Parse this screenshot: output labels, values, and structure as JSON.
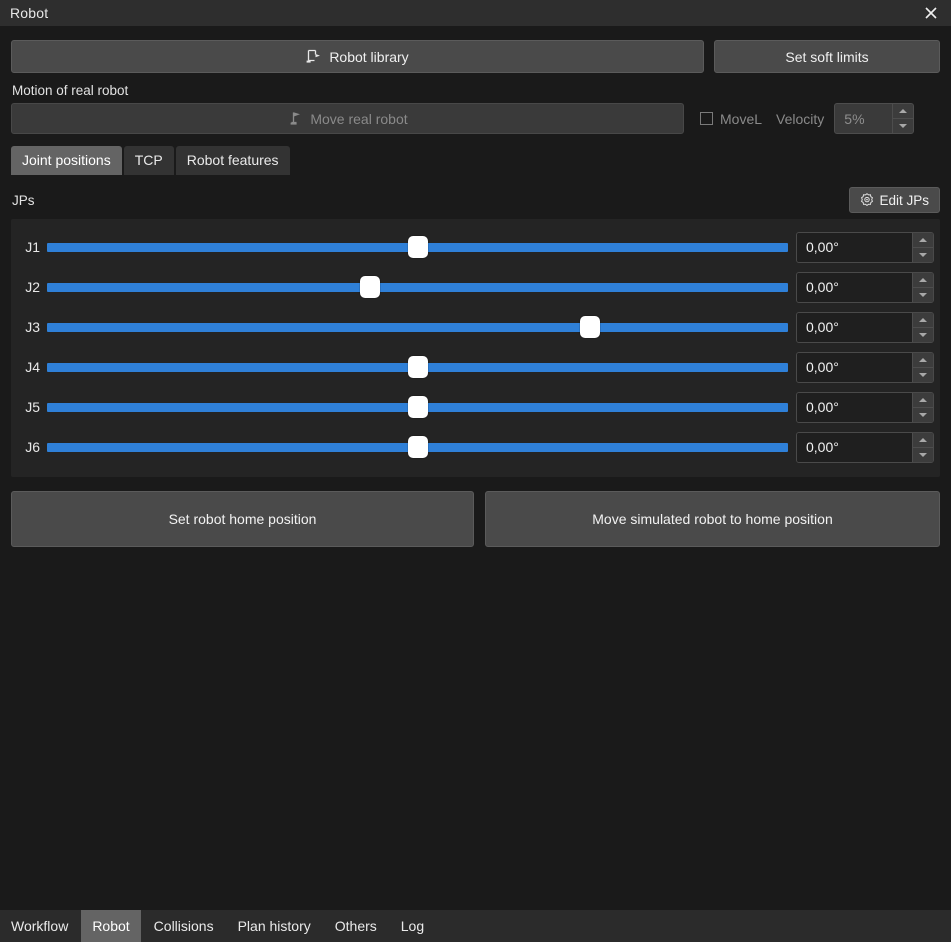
{
  "window": {
    "title": "Robot",
    "close_icon": "close-icon"
  },
  "toolbar": {
    "robot_library_label": "Robot library",
    "robot_library_icon": "robot-arm-icon",
    "set_soft_limits_label": "Set soft limits"
  },
  "motion": {
    "section_label": "Motion of real robot",
    "move_real_robot_label": "Move real robot",
    "move_real_robot_icon": "robot-arm-icon",
    "movel_label": "MoveL",
    "movel_checked": false,
    "velocity_label": "Velocity",
    "velocity_value": "5%",
    "spin_up_icon": "chevron-up-icon",
    "spin_down_icon": "chevron-down-icon"
  },
  "tabs": {
    "items": [
      {
        "label": "Joint positions",
        "active": true
      },
      {
        "label": "TCP",
        "active": false
      },
      {
        "label": "Robot features",
        "active": false
      }
    ]
  },
  "jps": {
    "label": "JPs",
    "edit_button_label": "Edit JPs",
    "edit_button_icon": "gear-target-icon",
    "track_color": "#2f80d8",
    "handle_color": "#ffffff",
    "joints": [
      {
        "name": "J1",
        "value": "0,00°",
        "handle_percent": 50.1
      },
      {
        "name": "J2",
        "value": "0,00°",
        "handle_percent": 43.6
      },
      {
        "name": "J3",
        "value": "0,00°",
        "handle_percent": 73.3
      },
      {
        "name": "J4",
        "value": "0,00°",
        "handle_percent": 50.1
      },
      {
        "name": "J5",
        "value": "0,00°",
        "handle_percent": 50.1
      },
      {
        "name": "J6",
        "value": "0,00°",
        "handle_percent": 50.1
      }
    ]
  },
  "home": {
    "set_home_label": "Set robot home position",
    "move_home_label": "Move simulated robot to home position"
  },
  "bottom_tabs": {
    "items": [
      {
        "label": "Workflow",
        "active": false
      },
      {
        "label": "Robot",
        "active": true
      },
      {
        "label": "Collisions",
        "active": false
      },
      {
        "label": "Plan history",
        "active": false
      },
      {
        "label": "Others",
        "active": false
      },
      {
        "label": "Log",
        "active": false
      }
    ]
  }
}
